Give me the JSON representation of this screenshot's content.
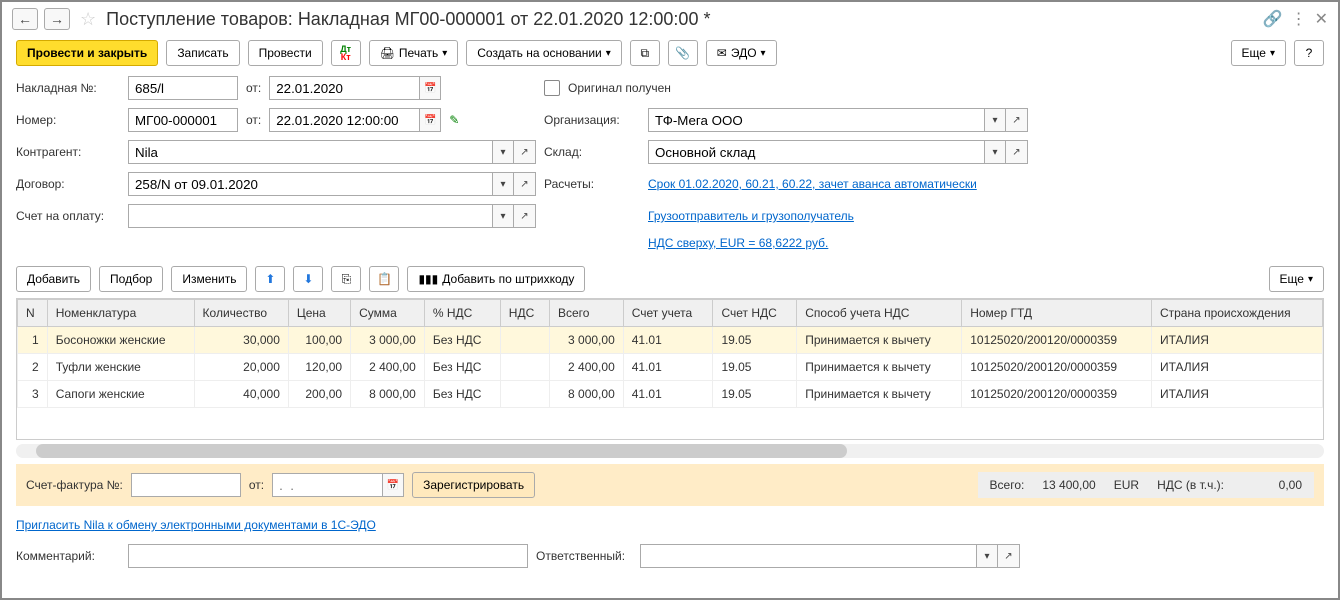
{
  "title": "Поступление товаров: Накладная МГ00-000001 от 22.01.2020 12:00:00 *",
  "toolbar": {
    "post_close": "Провести и закрыть",
    "write": "Записать",
    "post": "Провести",
    "print": "Печать",
    "create_based": "Создать на основании",
    "edo": "ЭДО",
    "more": "Еще",
    "help": "?"
  },
  "labels": {
    "invoice_no": "Накладная №:",
    "from": "от:",
    "number": "Номер:",
    "counterparty": "Контрагент:",
    "contract": "Договор:",
    "payment_account": "Счет на оплату:",
    "original_received": "Оригинал получен",
    "organization": "Организация:",
    "warehouse": "Склад:",
    "settlements": "Расчеты:",
    "comment": "Комментарий:",
    "responsible": "Ответственный:"
  },
  "fields": {
    "invoice_no": "685/l",
    "invoice_date": "22.01.2020",
    "number": "МГ00-000001",
    "datetime": "22.01.2020 12:00:00",
    "counterparty": "Nila",
    "contract": "258/N от 09.01.2020",
    "organization": "ТФ-Мега ООО",
    "warehouse": "Основной склад"
  },
  "links": {
    "settlements": "Срок 01.02.2020, 60.21, 60.22, зачет аванса автоматически",
    "consignor": "Грузоотправитель и грузополучатель",
    "vat": "НДС сверху, EUR = 68,6222 руб.",
    "invite_edo": "Пригласить Nila к обмену электронными документами в 1С-ЭДО"
  },
  "table_toolbar": {
    "add": "Добавить",
    "pick": "Подбор",
    "change": "Изменить",
    "barcode": "Добавить по штрихкоду",
    "more": "Еще"
  },
  "columns": {
    "n": "N",
    "item": "Номенклатура",
    "qty": "Количество",
    "price": "Цена",
    "sum": "Сумма",
    "vat_rate": "% НДС",
    "vat": "НДС",
    "total": "Всего",
    "account": "Счет учета",
    "vat_account": "Счет НДС",
    "vat_method": "Способ учета НДС",
    "gtd": "Номер ГТД",
    "country": "Страна происхождения"
  },
  "rows": [
    {
      "n": "1",
      "item": "Босоножки женские",
      "qty": "30,000",
      "price": "100,00",
      "sum": "3 000,00",
      "vat_rate": "Без НДС",
      "vat": "",
      "total": "3 000,00",
      "account": "41.01",
      "vat_account": "19.05",
      "vat_method": "Принимается к вычету",
      "gtd": "10125020/200120/0000359",
      "country": "ИТАЛИЯ",
      "selected": true
    },
    {
      "n": "2",
      "item": "Туфли женские",
      "qty": "20,000",
      "price": "120,00",
      "sum": "2 400,00",
      "vat_rate": "Без НДС",
      "vat": "",
      "total": "2 400,00",
      "account": "41.01",
      "vat_account": "19.05",
      "vat_method": "Принимается к вычету",
      "gtd": "10125020/200120/0000359",
      "country": "ИТАЛИЯ"
    },
    {
      "n": "3",
      "item": "Сапоги женские",
      "qty": "40,000",
      "price": "200,00",
      "sum": "8 000,00",
      "vat_rate": "Без НДС",
      "vat": "",
      "total": "8 000,00",
      "account": "41.01",
      "vat_account": "19.05",
      "vat_method": "Принимается к вычету",
      "gtd": "10125020/200120/0000359",
      "country": "ИТАЛИЯ"
    }
  ],
  "invoice": {
    "label": "Счет-фактура №:",
    "from": "от:",
    "date_placeholder": ".  .",
    "register": "Зарегистрировать"
  },
  "totals": {
    "label": "Всего:",
    "amount": "13 400,00",
    "currency": "EUR",
    "vat_label": "НДС (в т.ч.):",
    "vat_amount": "0,00"
  }
}
